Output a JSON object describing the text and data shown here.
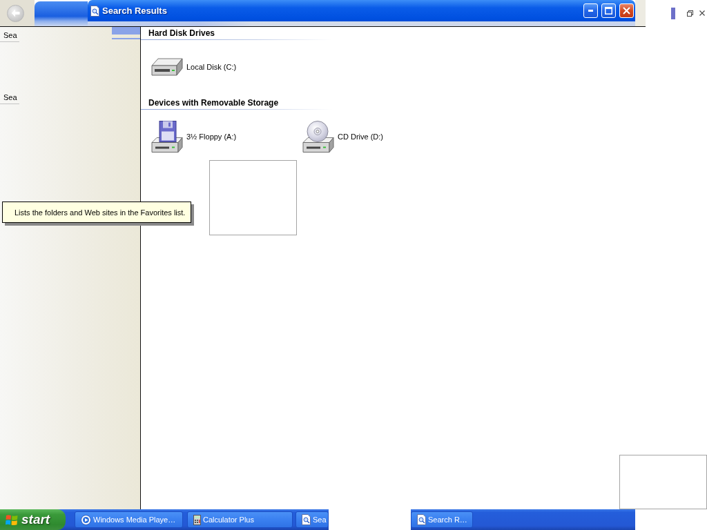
{
  "back_button": {
    "disabled": true
  },
  "window": {
    "title": "Search Results"
  },
  "left_pane": {
    "labels": [
      "Sea",
      "Sea"
    ]
  },
  "sections": [
    {
      "title": "Hard Disk Drives",
      "items": [
        {
          "kind": "hard-disk",
          "label": "Local Disk (C:)"
        }
      ]
    },
    {
      "title": "Devices with Removable Storage",
      "items": [
        {
          "kind": "floppy",
          "label": "3½ Floppy (A:)"
        },
        {
          "kind": "cd",
          "label": "CD Drive (D:)"
        }
      ]
    }
  ],
  "tooltip": {
    "text": "Lists the folders and Web sites in the Favorites list."
  },
  "taskbar": {
    "start": "start",
    "tasks": [
      {
        "kind": "media",
        "label": "Windows Media Playe…"
      },
      {
        "kind": "calculator",
        "label": "Calculator Plus"
      },
      {
        "kind": "search",
        "label": "Sea"
      },
      {
        "kind": "search",
        "label": "Search R…"
      }
    ]
  }
}
